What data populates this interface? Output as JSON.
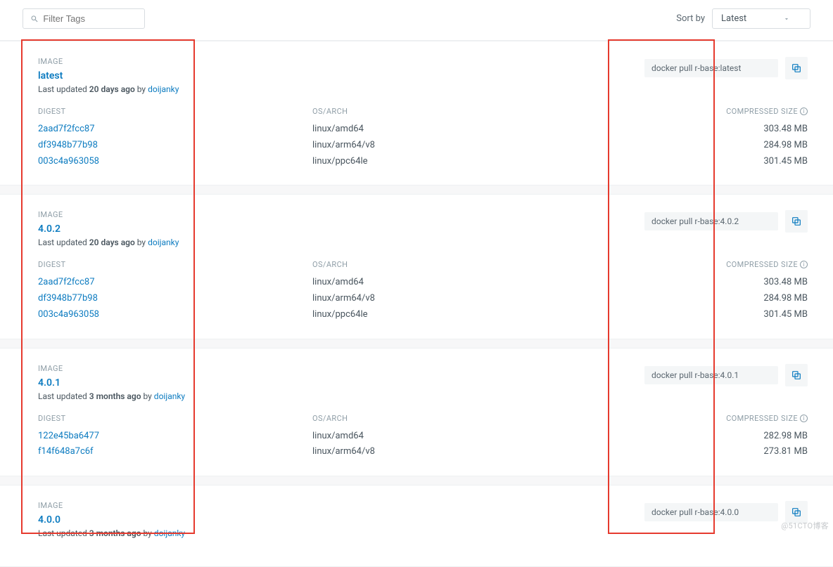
{
  "filter": {
    "placeholder": "Filter Tags"
  },
  "sort": {
    "label": "Sort by",
    "value": "Latest"
  },
  "labels": {
    "image": "IMAGE",
    "digest": "DIGEST",
    "osarch": "OS/ARCH",
    "size": "COMPRESSED SIZE",
    "last_updated_prefix": "Last updated",
    "by": "by"
  },
  "images": [
    {
      "tag": "latest",
      "updated": "20 days ago",
      "user": "doijanky",
      "pull": "docker pull r-base:latest",
      "rows": [
        {
          "digest": "2aad7f2fcc87",
          "arch": "linux/amd64",
          "size": "303.48 MB"
        },
        {
          "digest": "df3948b77b98",
          "arch": "linux/arm64/v8",
          "size": "284.98 MB"
        },
        {
          "digest": "003c4a963058",
          "arch": "linux/ppc64le",
          "size": "301.45 MB"
        }
      ]
    },
    {
      "tag": "4.0.2",
      "updated": "20 days ago",
      "user": "doijanky",
      "pull": "docker pull r-base:4.0.2",
      "rows": [
        {
          "digest": "2aad7f2fcc87",
          "arch": "linux/amd64",
          "size": "303.48 MB"
        },
        {
          "digest": "df3948b77b98",
          "arch": "linux/arm64/v8",
          "size": "284.98 MB"
        },
        {
          "digest": "003c4a963058",
          "arch": "linux/ppc64le",
          "size": "301.45 MB"
        }
      ]
    },
    {
      "tag": "4.0.1",
      "updated": "3 months ago",
      "user": "doijanky",
      "pull": "docker pull r-base:4.0.1",
      "rows": [
        {
          "digest": "122e45ba6477",
          "arch": "linux/amd64",
          "size": "282.98 MB"
        },
        {
          "digest": "f14f648a7c6f",
          "arch": "linux/arm64/v8",
          "size": "273.81 MB"
        }
      ]
    },
    {
      "tag": "4.0.0",
      "updated": "3 months ago",
      "user": "doijanky",
      "pull": "docker pull r-base:4.0.0",
      "rows": []
    }
  ],
  "watermark": "@51CTO博客"
}
